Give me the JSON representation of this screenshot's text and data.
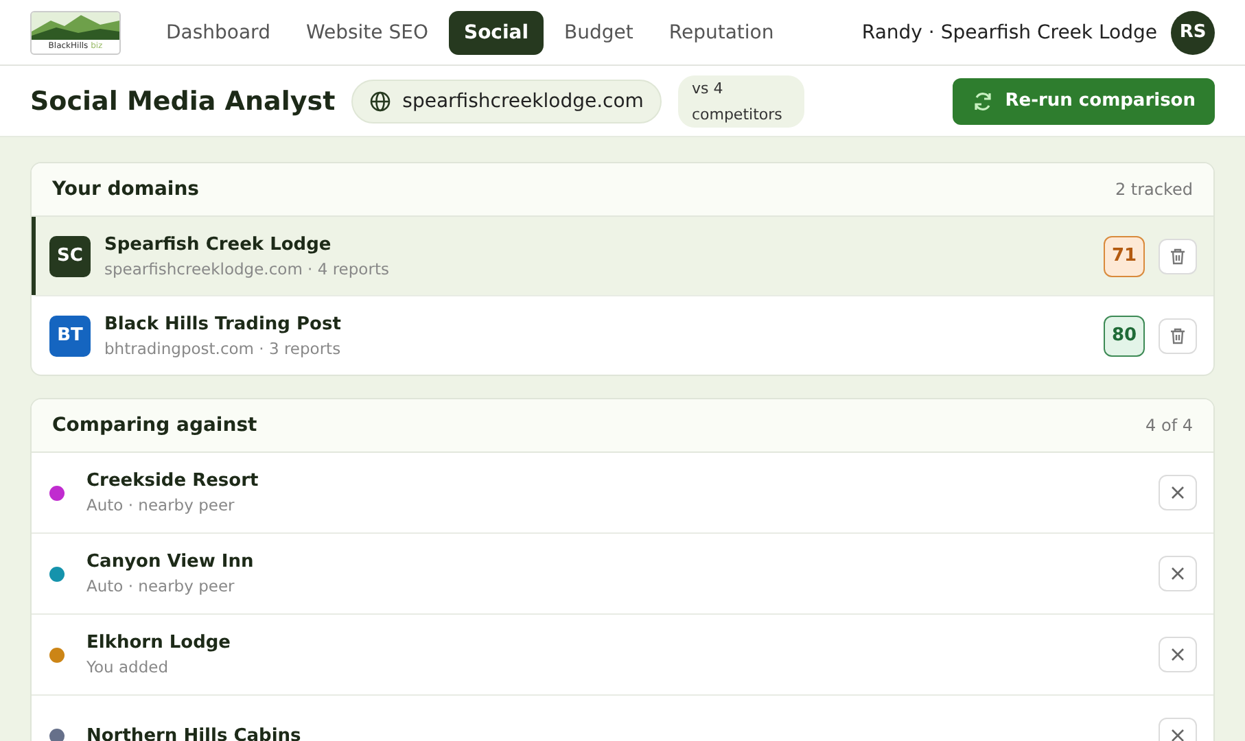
{
  "logo": {
    "name": "BlackHills",
    "suffix": "biz"
  },
  "nav": [
    {
      "label": "Dashboard",
      "selected": false
    },
    {
      "label": "Website SEO",
      "selected": false
    },
    {
      "label": "Social",
      "selected": true
    },
    {
      "label": "Budget",
      "selected": false
    },
    {
      "label": "Reputation",
      "selected": false
    }
  ],
  "user": {
    "label": "Randy · Spearfish Creek Lodge",
    "initials": "RS"
  },
  "page": {
    "title": "Social Media Analyst",
    "domain": "spearfishcreeklodge.com",
    "competitors": "vs 4 competitors",
    "action": "Re-run comparison"
  },
  "domains": {
    "title": "Your domains",
    "count": "2 tracked",
    "items": [
      {
        "initials": "SC",
        "color": "#26391f",
        "name": "Spearfish Creek Lodge",
        "meta": "spearfishcreeklodge.com · 4 reports",
        "score": "71",
        "kind": "warn",
        "selected": true
      },
      {
        "initials": "BT",
        "color": "#1565c0",
        "name": "Black Hills Trading Post",
        "meta": "bhtradingpost.com · 3 reports",
        "score": "80",
        "kind": "good",
        "selected": false
      }
    ]
  },
  "competitors": {
    "title": "Comparing against",
    "count": "4 of 4",
    "items": [
      {
        "color": "#c02ccf",
        "name": "Creekside Resort",
        "meta": "Auto · nearby peer"
      },
      {
        "color": "#1593ac",
        "name": "Canyon View Inn",
        "meta": "Auto · nearby peer"
      },
      {
        "color": "#cc8516",
        "name": "Elkhorn Lodge",
        "meta": "You added"
      },
      {
        "color": "#66708a",
        "name": "Northern Hills Cabins"
      }
    ]
  }
}
